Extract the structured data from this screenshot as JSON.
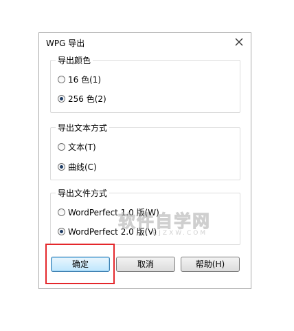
{
  "dialog": {
    "title": "WPG 导出",
    "close_icon": "close-icon"
  },
  "export_color": {
    "title": "导出颜色",
    "options": [
      {
        "label": "16 色(1)",
        "checked": false
      },
      {
        "label": "256 色(2)",
        "checked": true
      }
    ]
  },
  "export_text": {
    "title": "导出文本方式",
    "options": [
      {
        "label": "文本(T)",
        "checked": false
      },
      {
        "label": "曲线(C)",
        "checked": true
      }
    ]
  },
  "export_file": {
    "title": "导出文件方式",
    "options": [
      {
        "label": "WordPerfect 1.0 版(W)",
        "checked": false
      },
      {
        "label": "WordPerfect 2.0 版(V)",
        "checked": true
      }
    ]
  },
  "buttons": {
    "ok": "确定",
    "cancel": "取消",
    "help": "帮助(H)"
  },
  "watermark": {
    "main": "软件自学网",
    "sub": "RJZXW.COM"
  },
  "colors": {
    "highlight": "#e4272b",
    "default_button": "#bee6fd"
  }
}
